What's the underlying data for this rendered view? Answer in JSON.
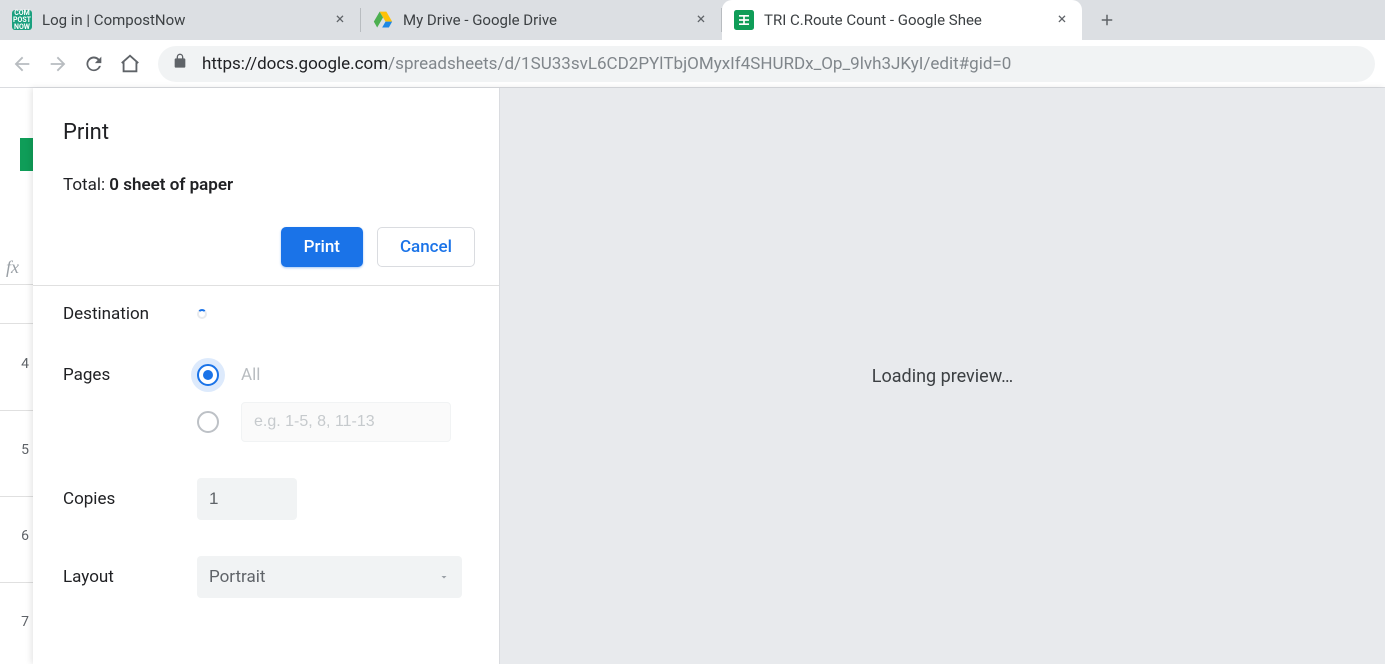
{
  "tabs": [
    {
      "title": "Log in | CompostNow",
      "active": false,
      "favicon": "compost"
    },
    {
      "title": "My Drive - Google Drive",
      "active": false,
      "favicon": "drive"
    },
    {
      "title": "TRI C.Route Count - Google Sheets",
      "active": true,
      "favicon": "sheets",
      "title_truncated": "TRI C.Route Count - Google Shee"
    }
  ],
  "address_bar": {
    "url_host": "https://docs.google.com",
    "url_path": "/spreadsheets/d/1SU33svL6CD2PYlTbjOMyxIf4SHURDx_Op_9lvh3JKyI/edit#gid=0"
  },
  "sheet_rows": [
    "4",
    "5",
    "6",
    "7"
  ],
  "fx_label": "fx",
  "print_dialog": {
    "title": "Print",
    "total_prefix": "Total: ",
    "total_value": "0 sheet of paper",
    "buttons": {
      "print": "Print",
      "cancel": "Cancel"
    },
    "destination_label": "Destination",
    "pages": {
      "label": "Pages",
      "all": "All",
      "custom_placeholder": "e.g. 1-5, 8, 11-13"
    },
    "copies": {
      "label": "Copies",
      "value": "1"
    },
    "layout": {
      "label": "Layout",
      "value": "Portrait"
    },
    "preview_text": "Loading preview…"
  }
}
